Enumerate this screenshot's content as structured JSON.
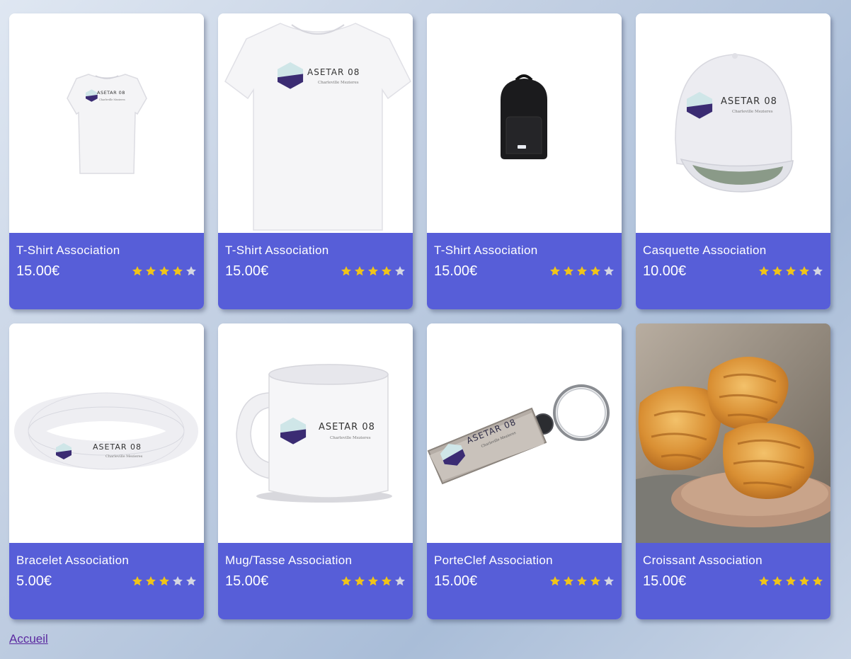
{
  "colors": {
    "card_footer": "#575ed8",
    "star_filled": "#f0c419",
    "star_empty": "#d4d6e2",
    "link": "#5b2aa0"
  },
  "products": [
    {
      "name": "T-Shirt Association",
      "price": "15.00€",
      "rating": 4,
      "image": "tshirt-small-image",
      "logo": {
        "title": "ASETAR 08",
        "subtitle": "Charleville Mezieres"
      }
    },
    {
      "name": "T-Shirt Association",
      "price": "15.00€",
      "rating": 4,
      "image": "tshirt-large-image",
      "logo": {
        "title": "ASETAR 08",
        "subtitle": "Charleville Mezieres"
      }
    },
    {
      "name": "T-Shirt Association",
      "price": "15.00€",
      "rating": 4,
      "image": "backpack-image"
    },
    {
      "name": "Casquette Association",
      "price": "10.00€",
      "rating": 4,
      "image": "cap-image",
      "logo": {
        "title": "ASETAR 08",
        "subtitle": "Charleville Mezieres"
      }
    },
    {
      "name": "Bracelet Association",
      "price": "5.00€",
      "rating": 3,
      "image": "bracelet-image",
      "logo": {
        "title": "ASETAR 08",
        "subtitle": "Charleville Mezieres"
      }
    },
    {
      "name": "Mug/Tasse Association",
      "price": "15.00€",
      "rating": 4,
      "image": "mug-image",
      "logo": {
        "title": "ASETAR 08",
        "subtitle": "Charleville Mezieres"
      }
    },
    {
      "name": "PorteClef Association",
      "price": "15.00€",
      "rating": 4,
      "image": "keychain-image",
      "logo": {
        "title": "ASETAR 08",
        "subtitle": "Charleville Mezieres"
      }
    },
    {
      "name": "Croissant Association",
      "price": "15.00€",
      "rating": 5,
      "image": "croissant-image"
    }
  ],
  "footer": {
    "home_link": "Accueil"
  }
}
